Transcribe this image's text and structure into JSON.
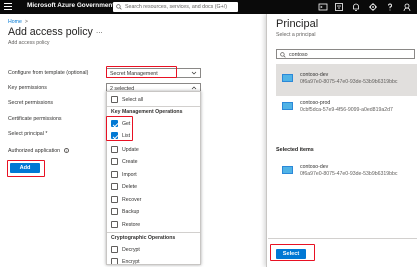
{
  "topbar": {
    "brand": "Microsoft Azure Government",
    "search_placeholder": "Search resources, services, and docs (G+/)",
    "icons": [
      "cloud-shell-icon",
      "directory-filter-icon",
      "notifications-icon",
      "settings-icon",
      "help-icon",
      "feedback-icon"
    ]
  },
  "breadcrumb": {
    "home": "Home",
    "chevron": ">"
  },
  "page": {
    "title": "Add access policy",
    "more": "...",
    "subtitle": "Add access policy"
  },
  "form": {
    "template_label": "Configure from template (optional)",
    "template_value": "Secret Management",
    "key_permissions_label": "Key permissions",
    "key_permissions_value": "2 selected",
    "secret_permissions_label": "Secret permissions",
    "certificate_permissions_label": "Certificate permissions",
    "select_principal_label": "Select principal *",
    "authorized_application_label": "Authorized application",
    "info_glyph": "i",
    "add_button": "Add"
  },
  "dropdown": {
    "select_all": "Select all",
    "groups": [
      {
        "name": "Key Management Operations",
        "items": [
          {
            "label": "Get",
            "checked": true
          },
          {
            "label": "List",
            "checked": true
          },
          {
            "label": "Update",
            "checked": false
          },
          {
            "label": "Create",
            "checked": false
          },
          {
            "label": "Import",
            "checked": false
          },
          {
            "label": "Delete",
            "checked": false
          },
          {
            "label": "Recover",
            "checked": false
          },
          {
            "label": "Backup",
            "checked": false
          },
          {
            "label": "Restore",
            "checked": false
          }
        ]
      },
      {
        "name": "Cryptographic Operations",
        "items": [
          {
            "label": "Decrypt",
            "checked": false
          },
          {
            "label": "Encrypt",
            "checked": false
          }
        ]
      }
    ]
  },
  "principal": {
    "title": "Principal",
    "subtitle": "Select a principal",
    "search_value": "contoso",
    "results": [
      {
        "name": "contoso-dev",
        "id": "0f6a97e0-8075-47e0-93de-53b9b6319bbc",
        "selected": true
      },
      {
        "name": "contoso-prod",
        "id": "0cbf5dca-57e9-4f56-9099-a0ed819a2d7",
        "selected": false
      }
    ],
    "selected_heading": "Selected items",
    "selected_items": [
      {
        "name": "contoso-dev",
        "id": "0f6a97e0-8075-47e0-93de-53b9b6319bbc"
      }
    ],
    "select_button": "Select"
  },
  "colors": {
    "accent": "#0078d4",
    "highlight_box": "#e81123",
    "topbar": "#0a0a0a"
  }
}
